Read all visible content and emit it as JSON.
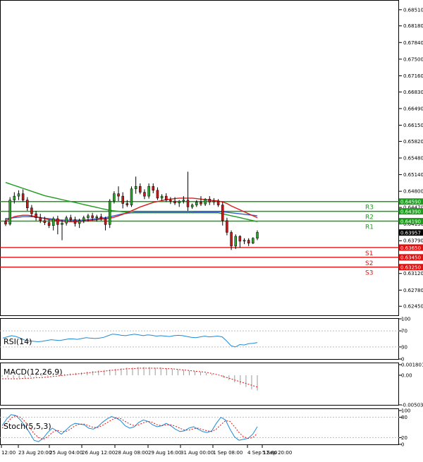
{
  "chart_data": [
    {
      "type": "candlestick",
      "panel": "price",
      "y_ticks": [
        "0.68510",
        "0.68180",
        "0.67840",
        "0.67500",
        "0.67160",
        "0.66830",
        "0.66490",
        "0.66150",
        "0.65820",
        "0.65480",
        "0.65140",
        "0.64800",
        "0.64470",
        "0.64130",
        "0.63790",
        "0.63450",
        "0.63120",
        "0.62780",
        "0.62450"
      ],
      "ylim": [
        0.6228,
        0.6868
      ],
      "last_price": "0.63957",
      "levels": [
        {
          "name": "R3",
          "label": "0.64590",
          "value": 0.6459,
          "color": "#1e9b1e"
        },
        {
          "name": "R2",
          "label": "0.64390",
          "value": 0.6439,
          "color": "#1e9b1e"
        },
        {
          "name": "R1",
          "label": "0.64190",
          "value": 0.6419,
          "color": "#1e9b1e"
        },
        {
          "name": "S1",
          "label": "0.63650",
          "value": 0.6365,
          "color": "#e01010"
        },
        {
          "name": "S2",
          "label": "0.63450",
          "value": 0.6345,
          "color": "#e01010"
        },
        {
          "name": "S3",
          "label": "0.63250",
          "value": 0.6325,
          "color": "#e01010"
        }
      ],
      "candles": [
        [
          0.6418,
          0.6425,
          0.6409,
          0.6413
        ],
        [
          0.6413,
          0.6468,
          0.641,
          0.6462
        ],
        [
          0.6462,
          0.6478,
          0.6455,
          0.647
        ],
        [
          0.647,
          0.6482,
          0.6462,
          0.6475
        ],
        [
          0.6475,
          0.6484,
          0.6458,
          0.6462
        ],
        [
          0.6462,
          0.6468,
          0.644,
          0.6446
        ],
        [
          0.6446,
          0.6452,
          0.6428,
          0.6434
        ],
        [
          0.6434,
          0.644,
          0.642,
          0.6426
        ],
        [
          0.6426,
          0.6434,
          0.6415,
          0.642
        ],
        [
          0.642,
          0.6428,
          0.6411,
          0.6416
        ],
        [
          0.6416,
          0.6422,
          0.6405,
          0.641
        ],
        [
          0.641,
          0.6428,
          0.64,
          0.6424
        ],
        [
          0.6424,
          0.643,
          0.6392,
          0.6412
        ],
        [
          0.6412,
          0.6422,
          0.638,
          0.6415
        ],
        [
          0.6415,
          0.643,
          0.641,
          0.6426
        ],
        [
          0.6426,
          0.6432,
          0.6418,
          0.6422
        ],
        [
          0.6422,
          0.6428,
          0.6408,
          0.6414
        ],
        [
          0.6414,
          0.6424,
          0.6405,
          0.642
        ],
        [
          0.642,
          0.643,
          0.6415,
          0.6426
        ],
        [
          0.6426,
          0.6434,
          0.6418,
          0.643
        ],
        [
          0.643,
          0.6436,
          0.642,
          0.6426
        ],
        [
          0.6426,
          0.6432,
          0.6418,
          0.6428
        ],
        [
          0.6428,
          0.6434,
          0.642,
          0.6424
        ],
        [
          0.6424,
          0.6428,
          0.64,
          0.6412
        ],
        [
          0.6412,
          0.6464,
          0.6405,
          0.646
        ],
        [
          0.646,
          0.648,
          0.6455,
          0.6475
        ],
        [
          0.6475,
          0.649,
          0.646,
          0.647
        ],
        [
          0.647,
          0.6478,
          0.6445,
          0.6455
        ],
        [
          0.6455,
          0.6462,
          0.6448,
          0.6452
        ],
        [
          0.6452,
          0.649,
          0.6448,
          0.6485
        ],
        [
          0.6485,
          0.651,
          0.6475,
          0.649
        ],
        [
          0.649,
          0.6496,
          0.6474,
          0.6478
        ],
        [
          0.6478,
          0.6484,
          0.6464,
          0.647
        ],
        [
          0.647,
          0.6496,
          0.6465,
          0.649
        ],
        [
          0.649,
          0.6496,
          0.6476,
          0.6482
        ],
        [
          0.6482,
          0.6488,
          0.6462,
          0.6466
        ],
        [
          0.6466,
          0.6474,
          0.646,
          0.647
        ],
        [
          0.647,
          0.6476,
          0.6458,
          0.6462
        ],
        [
          0.6462,
          0.6468,
          0.6454,
          0.646
        ],
        [
          0.646,
          0.6468,
          0.6452,
          0.6456
        ],
        [
          0.6456,
          0.6462,
          0.6448,
          0.646
        ],
        [
          0.646,
          0.647,
          0.6455,
          0.6462
        ],
        [
          0.6462,
          0.652,
          0.644,
          0.6448
        ],
        [
          0.6448,
          0.6455,
          0.6444,
          0.6452
        ],
        [
          0.6452,
          0.6462,
          0.6448,
          0.6458
        ],
        [
          0.6458,
          0.647,
          0.645,
          0.6454
        ],
        [
          0.6454,
          0.6466,
          0.645,
          0.6464
        ],
        [
          0.6464,
          0.647,
          0.6452,
          0.6458
        ],
        [
          0.6458,
          0.6466,
          0.6452,
          0.646
        ],
        [
          0.646,
          0.6464,
          0.6448,
          0.6452
        ],
        [
          0.6452,
          0.6458,
          0.641,
          0.642
        ],
        [
          0.642,
          0.6426,
          0.639,
          0.6396
        ],
        [
          0.6396,
          0.64,
          0.636,
          0.6368
        ],
        [
          0.6368,
          0.6392,
          0.6362,
          0.6388
        ],
        [
          0.6388,
          0.639,
          0.6365,
          0.6378
        ],
        [
          0.6378,
          0.6384,
          0.6372,
          0.638
        ],
        [
          0.638,
          0.6384,
          0.6368,
          0.6374
        ],
        [
          0.6374,
          0.6386,
          0.6372,
          0.6384
        ],
        [
          0.6384,
          0.64,
          0.638,
          0.6396
        ]
      ],
      "ma_series": [
        {
          "color": "#1e9b1e",
          "values": [
            0.6498,
            0.6495,
            0.6492,
            0.6489,
            0.6486,
            0.6483,
            0.648,
            0.6477,
            0.6474,
            0.6471,
            0.6469,
            0.6467,
            0.6465,
            0.6463,
            0.6461,
            0.6459,
            0.6457,
            0.6455,
            0.6453,
            0.6451,
            0.6449,
            0.6447,
            0.6445,
            0.6443,
            0.6441,
            0.644,
            0.6439,
            0.6438,
            0.6437,
            0.6436,
            0.6436,
            0.6436,
            0.6436,
            0.6436,
            0.6436,
            0.6436,
            0.6436,
            0.6436,
            0.6436,
            0.6436,
            0.6436,
            0.6436,
            0.6436,
            0.6436,
            0.6436,
            0.6436,
            0.6436,
            0.6436,
            0.6436,
            0.6436,
            0.6434,
            0.6432,
            0.643,
            0.6428,
            0.6426,
            0.6424,
            0.6422,
            0.642,
            0.6418
          ]
        },
        {
          "color": "#3a5fd0",
          "values": [
            0.6424,
            0.6425,
            0.6426,
            0.6427,
            0.6428,
            0.6428,
            0.6428,
            0.6427,
            0.6426,
            0.6425,
            0.6424,
            0.6423,
            0.6422,
            0.6421,
            0.6421,
            0.6421,
            0.6421,
            0.6421,
            0.6421,
            0.6422,
            0.6423,
            0.6424,
            0.6425,
            0.6426,
            0.6428,
            0.643,
            0.6432,
            0.6434,
            0.6435,
            0.6436,
            0.6437,
            0.6437,
            0.6437,
            0.6437,
            0.6437,
            0.6437,
            0.6437,
            0.6437,
            0.6437,
            0.6437,
            0.6437,
            0.6437,
            0.6437,
            0.6437,
            0.6438,
            0.6438,
            0.6438,
            0.6438,
            0.6438,
            0.6438,
            0.6438,
            0.6437,
            0.6436,
            0.6435,
            0.6434,
            0.6433,
            0.6432,
            0.6431,
            0.643
          ]
        },
        {
          "color": "#d81e1e",
          "values": [
            0.642,
            0.6424,
            0.6428,
            0.643,
            0.6431,
            0.6431,
            0.643,
            0.6428,
            0.6426,
            0.6424,
            0.6422,
            0.6421,
            0.642,
            0.6419,
            0.6418,
            0.6418,
            0.6418,
            0.6418,
            0.6419,
            0.642,
            0.6421,
            0.6422,
            0.6423,
            0.6424,
            0.6425,
            0.6427,
            0.643,
            0.6433,
            0.6436,
            0.644,
            0.6444,
            0.6448,
            0.6451,
            0.6454,
            0.6457,
            0.6459,
            0.6461,
            0.6463,
            0.6464,
            0.6465,
            0.6466,
            0.6466,
            0.6466,
            0.6466,
            0.6465,
            0.6464,
            0.6463,
            0.6462,
            0.6461,
            0.646,
            0.6458,
            0.6455,
            0.645,
            0.6446,
            0.6442,
            0.6438,
            0.6434,
            0.643,
            0.6426
          ]
        }
      ],
      "x_ticks": [
        "12:00",
        "23 Aug 20:00",
        "25 Aug 04:00",
        "26 Aug 12:00",
        "28 Aug 08:00",
        "29 Aug 16:00",
        "31 Aug 00:00",
        "1 Sep 08:00",
        "4 Sep 12:00",
        "5 Sep 20:00"
      ]
    },
    {
      "type": "line",
      "panel": "rsi",
      "label": "RSI(14)",
      "y_ticks": [
        "100",
        "70",
        "30",
        "0"
      ],
      "ylim": [
        0,
        100
      ],
      "color": "#1e8ad6",
      "values": [
        52,
        55,
        58,
        56,
        52,
        47,
        45,
        44,
        43,
        44,
        46,
        48,
        47,
        46,
        48,
        50,
        50,
        49,
        51,
        53,
        52,
        51,
        52,
        54,
        58,
        62,
        61,
        59,
        58,
        60,
        62,
        60,
        58,
        60,
        59,
        57,
        58,
        57,
        56,
        58,
        59,
        58,
        56,
        54,
        53,
        55,
        57,
        55,
        56,
        57,
        55,
        45,
        33,
        30,
        36,
        35,
        38,
        39,
        41
      ]
    },
    {
      "type": "histogram",
      "panel": "macd",
      "label": "MACD(12,26,9)",
      "y_ticks": [
        "0.001801",
        "0.00",
        "-0.005035"
      ],
      "ylim": [
        -0.005035,
        0.001801
      ],
      "values": [
        -0.0003,
        -0.0004,
        -0.0005,
        -0.0005,
        -0.0004,
        -0.0003,
        -0.0002,
        -0.0002,
        -0.0001,
        0.0,
        0.0001,
        0.0002,
        0.0003,
        0.0004,
        0.0005,
        0.0006,
        0.0007,
        0.0008,
        0.0009,
        0.001,
        0.0011,
        0.0012,
        0.0013,
        0.0013,
        0.0014,
        0.0014,
        0.0014,
        0.0013,
        0.0013,
        0.0012,
        0.0011,
        0.001,
        0.0009,
        0.0008,
        0.0007,
        0.0006,
        0.0004,
        0.0002,
        0.0,
        -0.0004,
        -0.0008,
        -0.0012,
        -0.0016,
        -0.002,
        -0.0024,
        -0.0026
      ],
      "signal": [
        -0.0006,
        -0.0006,
        -0.0006,
        -0.0006,
        -0.0005,
        -0.0005,
        -0.0004,
        -0.0004,
        -0.0003,
        -0.0002,
        -0.0001,
        0.0,
        0.0001,
        0.0002,
        0.0003,
        0.0004,
        0.0005,
        0.0006,
        0.0007,
        0.0008,
        0.0009,
        0.001,
        0.0011,
        0.0011,
        0.0012,
        0.0012,
        0.0012,
        0.0012,
        0.0012,
        0.0011,
        0.0011,
        0.001,
        0.0009,
        0.0008,
        0.0007,
        0.0006,
        0.0005,
        0.0003,
        0.0001,
        -0.0002,
        -0.0005,
        -0.0008,
        -0.0011,
        -0.0014,
        -0.0017,
        -0.002
      ],
      "signal_color": "#e01010"
    },
    {
      "type": "line",
      "panel": "stoch",
      "label": "Stoch(5,5,3)",
      "y_ticks": [
        "100",
        "80",
        "20",
        "0"
      ],
      "ylim": [
        0,
        100
      ],
      "series": [
        {
          "color": "#1e8ad6",
          "values": [
            55,
            75,
            88,
            85,
            72,
            55,
            35,
            12,
            8,
            18,
            35,
            48,
            40,
            30,
            42,
            55,
            62,
            60,
            58,
            48,
            45,
            52,
            65,
            75,
            82,
            78,
            70,
            55,
            48,
            52,
            65,
            72,
            68,
            58,
            52,
            55,
            62,
            55,
            45,
            38,
            40,
            48,
            52,
            45,
            38,
            35,
            40,
            62,
            80,
            72,
            45,
            22,
            12,
            15,
            18,
            30,
            52
          ]
        },
        {
          "color": "#e01010",
          "values": [
            48,
            62,
            78,
            85,
            80,
            68,
            50,
            32,
            20,
            15,
            22,
            35,
            42,
            38,
            38,
            45,
            55,
            60,
            60,
            55,
            50,
            50,
            56,
            64,
            72,
            78,
            76,
            68,
            60,
            55,
            58,
            64,
            68,
            65,
            58,
            55,
            58,
            58,
            54,
            48,
            42,
            42,
            46,
            48,
            44,
            40,
            38,
            45,
            58,
            70,
            68,
            52,
            35,
            22,
            18,
            20,
            32
          ]
        }
      ]
    }
  ]
}
